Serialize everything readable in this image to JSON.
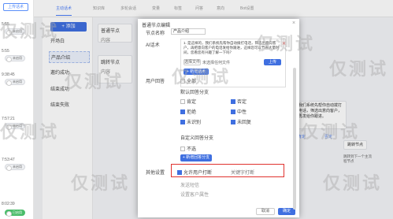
{
  "sidebar": {
    "upload_label": "上传话术",
    "items": [
      {
        "text": "5:55",
        "toggle": "未启用",
        "on": false
      },
      {
        "text": "5:55",
        "toggle": "未启用",
        "on": false
      },
      {
        "text": "9:38:45",
        "toggle": "未启用",
        "on": false
      },
      {
        "text": "7:57:21",
        "toggle": "未启用",
        "on": false
      },
      {
        "text": "7:53:47",
        "toggle": "未启用",
        "on": false
      },
      {
        "text": "8:02:39",
        "toggle": "已启用",
        "on": true
      }
    ]
  },
  "topnav": {
    "tabs": [
      "主动话术",
      "知识库",
      "多轮会话",
      "变量",
      "标签",
      "问答",
      "意向",
      "Bot设置"
    ]
  },
  "flow": {
    "add_label": "+ 添加",
    "nodes": [
      "开场白",
      "产品介绍",
      "邀约成功",
      "结束成功",
      "结束失败"
    ]
  },
  "canvas_cards": [
    {
      "title": "普通节点",
      "sub": "内容"
    },
    {
      "title": "跳转节点",
      "sub": "内容"
    }
  ],
  "modal": {
    "title": "普通节点编辑",
    "name_label": "节点名称",
    "name_value": "产品介绍",
    "ai_label": "AI话术",
    "ai_text": "1. 是这样的，我们系统先帮你自动拨打电话，筛选出意向客户，再把意向客户的电话发给你跟进，这样您可以节省大量时间，您看您有兴趣了解一下吗？",
    "select_file": "选择文件",
    "no_file": "未选择任何文件",
    "upload_btn": "上传",
    "add_speech": "+ 新增话术",
    "user_reply_label": "用户回答",
    "all_label": "全部",
    "default_branch_label": "默认回答分支",
    "options": [
      "肯定",
      "否定",
      "拒绝",
      "中性"
    ],
    "unrecognized": "未识别",
    "no_reply": "未回复",
    "custom_label": "自定义回答分支",
    "none_label": "不选",
    "add_branch": "+ 新增回答分支",
    "other_label": "其他设置",
    "allow_interrupt": "允许用户打断",
    "key_interrupt": "关键字打断",
    "send_sms": "发送短信",
    "customer_attr": "设置客户属性",
    "cancel": "取消",
    "confirm": "确定"
  },
  "right_panel": {
    "bubble": "我们系统先帮你自动拨打电话，筛选出意向客户，再发给你跟进。",
    "yes_tag": "肯定",
    "no_tag": "否定",
    "jump_node": "跳转节点",
    "jump_note": "跳转到下一个主流程节点"
  },
  "watermark": "仅测试"
}
